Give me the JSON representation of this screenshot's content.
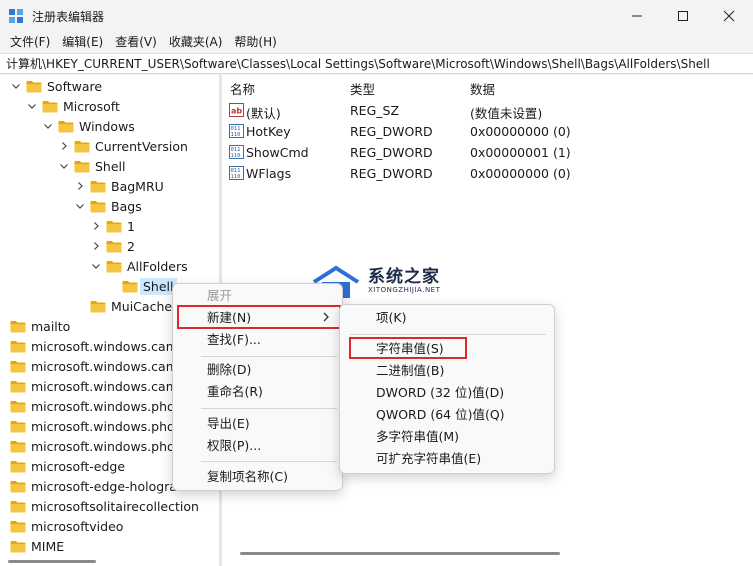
{
  "window": {
    "title": "注册表编辑器",
    "minimize_icon": "minimize-icon",
    "maximize_icon": "maximize-icon",
    "close_icon": "close-icon"
  },
  "menubar": [
    {
      "label": "文件(F)"
    },
    {
      "label": "编辑(E)"
    },
    {
      "label": "查看(V)"
    },
    {
      "label": "收藏夹(A)"
    },
    {
      "label": "帮助(H)"
    }
  ],
  "address": "计算机\\HKEY_CURRENT_USER\\Software\\Classes\\Local Settings\\Software\\Microsoft\\Windows\\Shell\\Bags\\AllFolders\\Shell",
  "tree": [
    {
      "label": "Software",
      "expanded": true
    },
    {
      "label": "Microsoft",
      "expanded": true
    },
    {
      "label": "Windows",
      "expanded": true
    },
    {
      "label": "CurrentVersion",
      "expanded": false
    },
    {
      "label": "Shell",
      "expanded": true
    },
    {
      "label": "BagMRU",
      "expanded": false
    },
    {
      "label": "Bags",
      "expanded": true
    },
    {
      "label": "1",
      "expanded": false
    },
    {
      "label": "2",
      "expanded": false
    },
    {
      "label": "AllFolders",
      "expanded": true
    },
    {
      "label": "Shell",
      "selected": true
    },
    {
      "label": "MuiCache"
    },
    {
      "label": "mailto"
    },
    {
      "label": "microsoft.windows.came"
    },
    {
      "label": "microsoft.windows.came"
    },
    {
      "label": "microsoft.windows.came"
    },
    {
      "label": "microsoft.windows.photo"
    },
    {
      "label": "microsoft.windows.photo"
    },
    {
      "label": "microsoft.windows.photo"
    },
    {
      "label": "microsoft-edge"
    },
    {
      "label": "microsoft-edge-hologra"
    },
    {
      "label": "microsoftsolitairecollection"
    },
    {
      "label": "microsoftvideo"
    },
    {
      "label": "MIME"
    }
  ],
  "list": {
    "headers": {
      "name": "名称",
      "type": "类型",
      "data": "数据"
    },
    "rows": [
      {
        "icon": "string-value-icon",
        "name": "(默认)",
        "type": "REG_SZ",
        "data": "(数值未设置)"
      },
      {
        "icon": "binary-value-icon",
        "name": "HotKey",
        "type": "REG_DWORD",
        "data": "0x00000000 (0)"
      },
      {
        "icon": "binary-value-icon",
        "name": "ShowCmd",
        "type": "REG_DWORD",
        "data": "0x00000001 (1)"
      },
      {
        "icon": "binary-value-icon",
        "name": "WFlags",
        "type": "REG_DWORD",
        "data": "0x00000000 (0)"
      }
    ]
  },
  "context_menu": {
    "items": [
      {
        "label": "展开",
        "disabled": true
      },
      {
        "label": "新建(N)",
        "submenu": true
      },
      {
        "label": "查找(F)..."
      },
      {
        "label": "删除(D)"
      },
      {
        "label": "重命名(R)"
      },
      {
        "label": "导出(E)"
      },
      {
        "label": "权限(P)..."
      },
      {
        "label": "复制项名称(C)"
      }
    ]
  },
  "submenu": {
    "items": [
      {
        "label": "项(K)"
      },
      {
        "label": "字符串值(S)"
      },
      {
        "label": "二进制值(B)"
      },
      {
        "label": "DWORD (32 位)值(D)"
      },
      {
        "label": "QWORD (64 位)值(Q)"
      },
      {
        "label": "多字符串值(M)"
      },
      {
        "label": "可扩充字符串值(E)"
      }
    ]
  },
  "watermark": {
    "title": "系统之家",
    "subtitle": "XITONGZHIJIA.NET"
  },
  "colors": {
    "folder": "#f5c542",
    "highlight_box": "#e0272b",
    "selection": "#cce8ff"
  }
}
